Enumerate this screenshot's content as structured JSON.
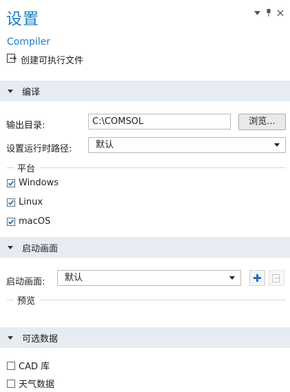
{
  "header": {
    "title": "设置",
    "subtitle": "Compiler",
    "action_label": "创建可执行文件"
  },
  "pane_controls": {
    "dropdown_icon": "chevron-down-icon",
    "pin_icon": "pin-icon",
    "close_icon": "close-icon"
  },
  "sections": {
    "compile": {
      "title": "编译",
      "output_dir_label": "输出目录:",
      "output_dir_value": "C:\\COMSOL",
      "browse_label": "浏览...",
      "runtime_path_label": "设置运行时路径:",
      "runtime_path_value": "默认",
      "platform_group": "平台",
      "platforms": [
        {
          "label": "Windows",
          "checked": true
        },
        {
          "label": "Linux",
          "checked": true
        },
        {
          "label": "macOS",
          "checked": true
        }
      ]
    },
    "splash": {
      "title": "启动画面",
      "splash_label": "启动画面:",
      "splash_value": "默认",
      "preview_group": "预览"
    },
    "optional": {
      "title": "可选数据",
      "items": [
        {
          "label": "CAD 库",
          "checked": false
        },
        {
          "label": "天气数据",
          "checked": false
        }
      ]
    }
  },
  "colors": {
    "accent": "#1a7fc4",
    "section_bg": "#e6ecf2",
    "check_blue": "#2a6ebd"
  }
}
